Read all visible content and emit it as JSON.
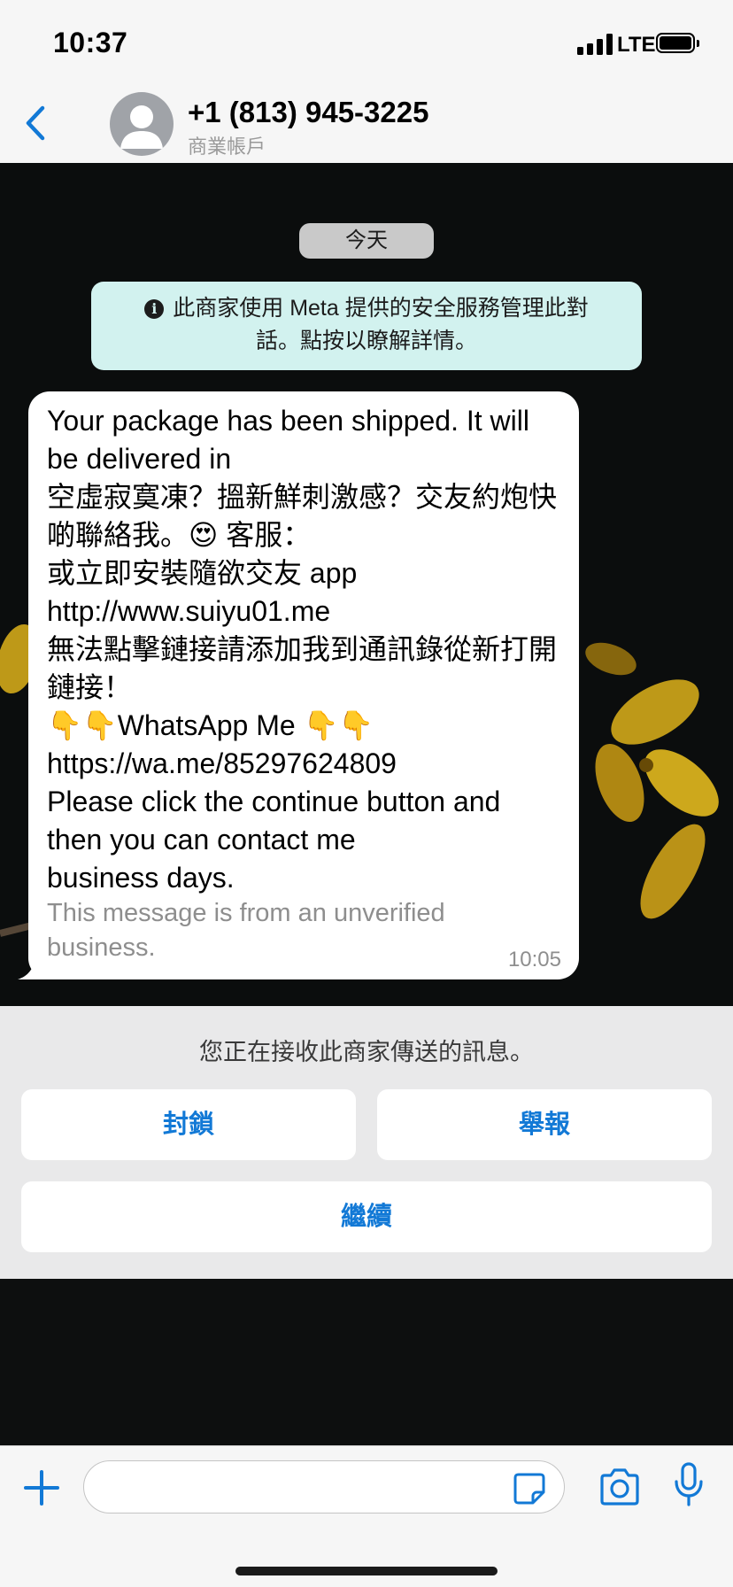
{
  "status_bar": {
    "time": "10:37",
    "network": "LTE"
  },
  "header": {
    "contact_name": "+1 (813) 945-3225",
    "subtitle": "商業帳戶"
  },
  "chat": {
    "date_label": "今天",
    "security_banner": "此商家使用 Meta 提供的安全服務管理此對話。點按以瞭解詳情。",
    "message": {
      "text": "Your package has been shipped. It will be delivered in\n空虛寂寞凍？搵新鮮刺激感？交友約炮快啲聯絡我。😍 客服：\n或立即安裝隨欲交友 app http://www.suiyu01.me\n無法點擊鏈接請添加我到通訊錄從新打開鏈接！\n👇👇WhatsApp Me 👇👇\nhttps://wa.me/85297624809\nPlease click the continue button and then you can contact me\n business days.",
      "unverified_note": "This message is from an unverified business.",
      "time": "10:05"
    }
  },
  "business_panel": {
    "note": "您正在接收此商家傳送的訊息。",
    "block_label": "封鎖",
    "report_label": "舉報",
    "continue_label": "繼續"
  },
  "composer": {
    "placeholder": ""
  },
  "colors": {
    "accent": "#1279d6",
    "banner": "#d2f2ef",
    "panel": "#e9e9ea"
  },
  "icons": [
    "back-chevron-icon",
    "avatar-icon",
    "info-icon",
    "plus-icon",
    "sticker-icon",
    "camera-icon",
    "microphone-icon"
  ]
}
